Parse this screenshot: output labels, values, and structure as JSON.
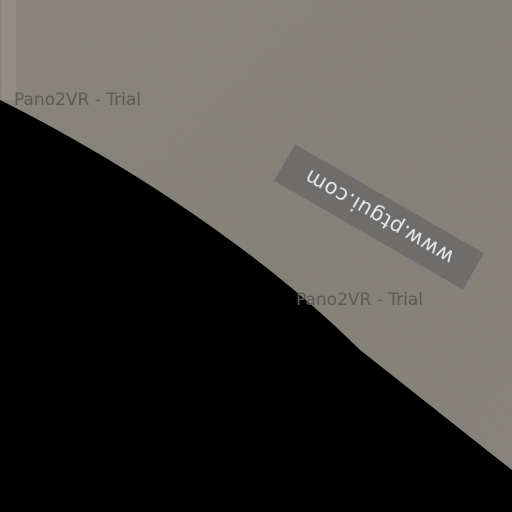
{
  "watermarks": {
    "pano_trial_1": "Pano2VR - Trial",
    "pano_trial_2": "Pano2VR - Trial",
    "ptgui_url": "www.ptgui.com"
  },
  "colors": {
    "surface": "#8b877f",
    "void": "#000000",
    "badge": "#6e6d6c",
    "watermark_text": "#5b5a55"
  }
}
